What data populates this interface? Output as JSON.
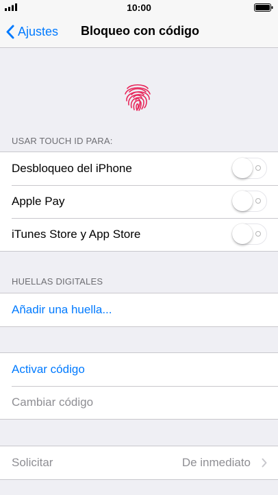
{
  "status_bar": {
    "time": "10:00",
    "signal_icon": "signal-bars-icon",
    "battery_icon": "battery-icon"
  },
  "nav": {
    "back_label": "Ajustes",
    "title": "Bloqueo con código"
  },
  "touch_id": {
    "icon": "fingerprint-icon",
    "header": "USAR TOUCH ID PARA:",
    "rows": [
      {
        "label": "Desbloqueo del iPhone",
        "enabled": false
      },
      {
        "label": "Apple Pay",
        "enabled": false
      },
      {
        "label": "iTunes Store y App Store",
        "enabled": false
      }
    ]
  },
  "fingerprints": {
    "header": "HUELLAS DIGITALES",
    "add_label": "Añadir una huella..."
  },
  "passcode": {
    "activate_label": "Activar código",
    "change_label": "Cambiar código"
  },
  "require": {
    "label": "Solicitar",
    "value": "De inmediato"
  },
  "colors": {
    "accent": "#007aff",
    "fingerprint": "#e8265a",
    "background": "#efeff4",
    "muted_text": "#8e8e93"
  }
}
